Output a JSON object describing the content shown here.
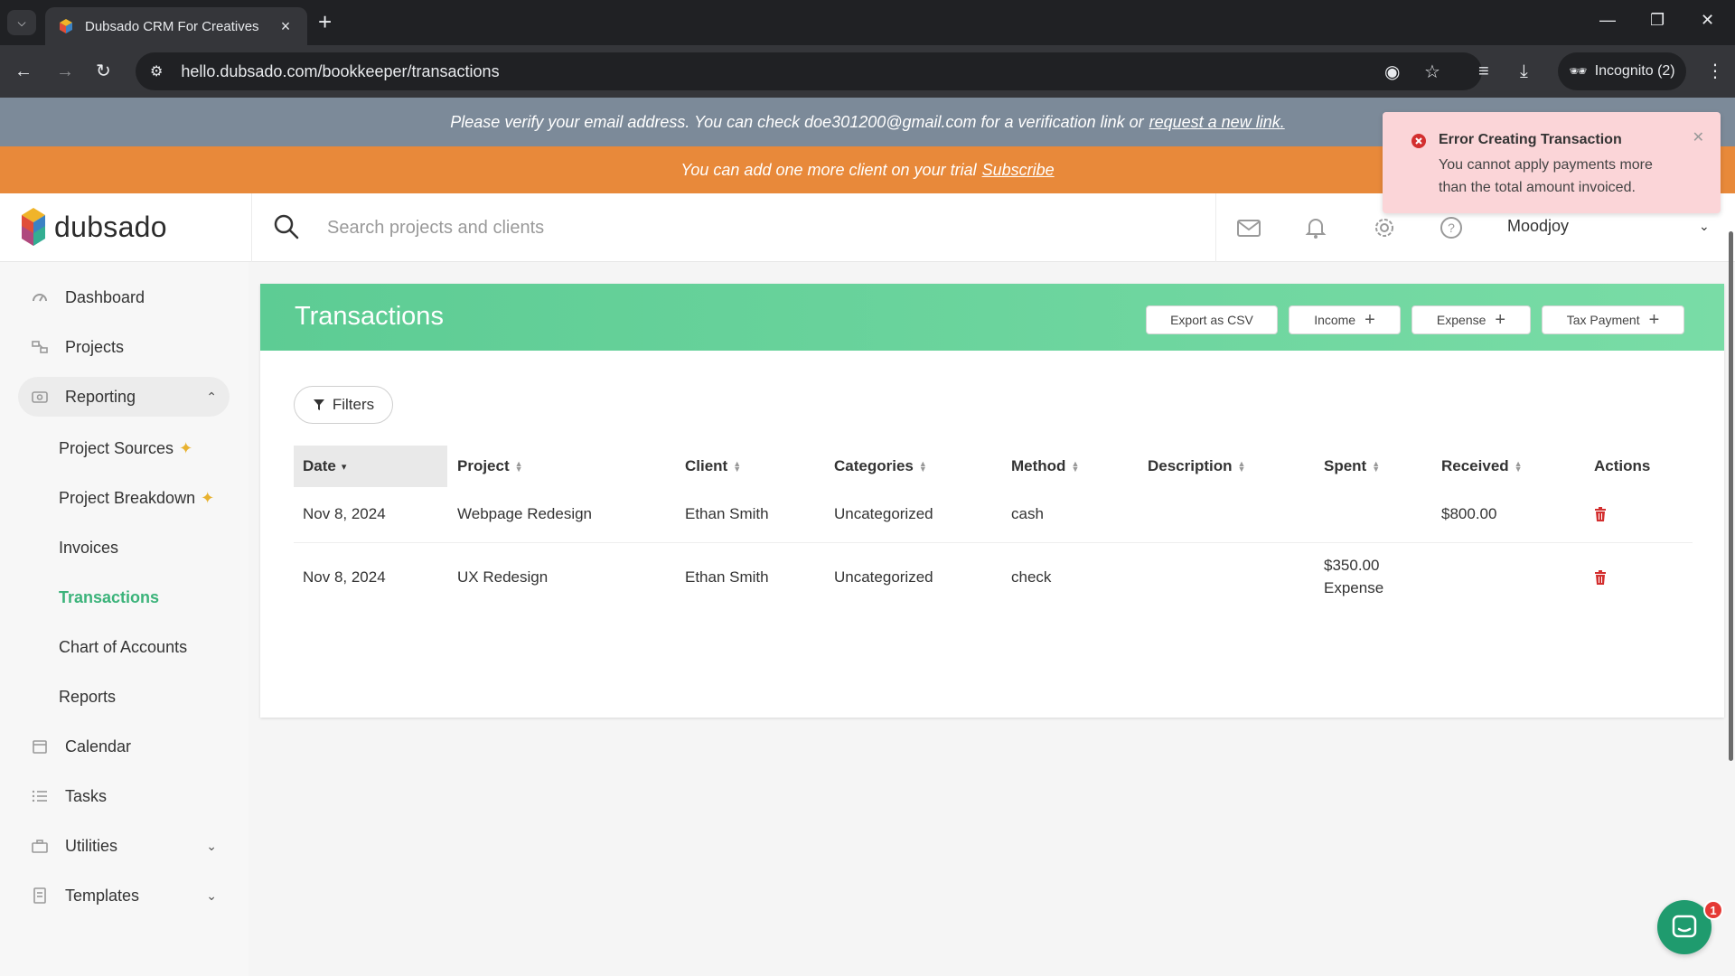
{
  "browser": {
    "tab_title": "Dubsado CRM For Creatives",
    "url": "hello.dubsado.com/bookkeeper/transactions",
    "incognito_label": "Incognito (2)"
  },
  "banners": {
    "verify_text": "Please verify your email address. You can check doe301200@gmail.com for a verification link or",
    "verify_link": "request a new link.",
    "trial_text": "You can add one more client on your trial",
    "trial_link": "Subscribe"
  },
  "header": {
    "logo_text": "dubsado",
    "search_placeholder": "Search projects and clients",
    "user_name": "Moodjoy"
  },
  "sidebar": {
    "items": [
      {
        "label": "Dashboard",
        "icon": "gauge-icon"
      },
      {
        "label": "Projects",
        "icon": "projects-icon"
      },
      {
        "label": "Reporting",
        "icon": "reporting-icon"
      },
      {
        "label": "Calendar",
        "icon": "calendar-icon"
      },
      {
        "label": "Tasks",
        "icon": "tasks-icon"
      },
      {
        "label": "Utilities",
        "icon": "utilities-icon"
      },
      {
        "label": "Templates",
        "icon": "templates-icon"
      }
    ],
    "reporting_sub": [
      {
        "label": "Project Sources"
      },
      {
        "label": "Project Breakdown"
      },
      {
        "label": "Invoices"
      },
      {
        "label": "Transactions"
      },
      {
        "label": "Chart of Accounts"
      },
      {
        "label": "Reports"
      }
    ]
  },
  "page": {
    "title": "Transactions",
    "buttons": {
      "export": "Export as CSV",
      "income": "Income",
      "expense": "Expense",
      "tax": "Tax Payment"
    },
    "filters_label": "Filters"
  },
  "table": {
    "columns": [
      "Date",
      "Project",
      "Client",
      "Categories",
      "Method",
      "Description",
      "Spent",
      "Received",
      "Actions"
    ],
    "rows": [
      {
        "date": "Nov 8, 2024",
        "project": "Webpage Redesign",
        "client": "Ethan Smith",
        "category": "Uncategorized",
        "method": "cash",
        "description": "",
        "spent": "",
        "spent_sub": "",
        "received": "$800.00"
      },
      {
        "date": "Nov 8, 2024",
        "project": "UX Redesign",
        "client": "Ethan Smith",
        "category": "Uncategorized",
        "method": "check",
        "description": "",
        "spent": "$350.00",
        "spent_sub": "Expense",
        "received": ""
      }
    ]
  },
  "toast": {
    "title": "Error Creating Transaction",
    "message": "You cannot apply payments more than the total amount invoiced."
  },
  "chat": {
    "badge_count": "1"
  },
  "colors": {
    "accent_green": "#3bb37a",
    "header_green": "#5dcc94",
    "trial_orange": "#e8893a",
    "verify_gray": "#7c8a99",
    "toast_bg": "#fbd5d8",
    "error_red": "#d32f2f",
    "sparkle_gold": "#e8b230"
  }
}
